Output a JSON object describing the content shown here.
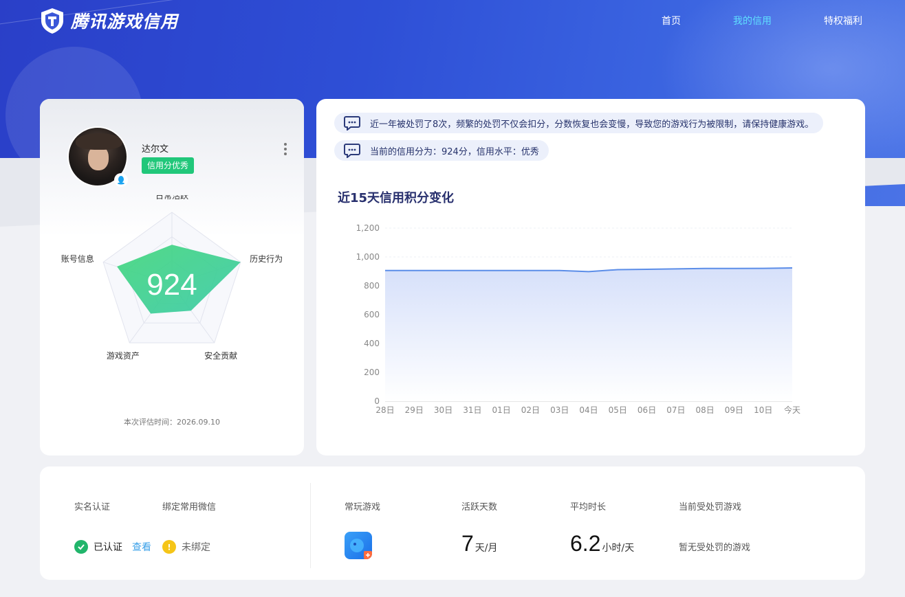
{
  "header": {
    "logo_text": "腾讯游戏信用",
    "nav": [
      {
        "label": "首页",
        "active": false
      },
      {
        "label": "我的信用",
        "active": true
      },
      {
        "label": "特权福利",
        "active": false
      }
    ]
  },
  "profile": {
    "username": "达尔文",
    "badge": "信用分优秀",
    "score": "924",
    "radar_axes": [
      "日常活跃",
      "历史行为",
      "安全贡献",
      "游戏资产",
      "账号信息"
    ],
    "radar_values": [
      0.55,
      1.0,
      0.45,
      0.5,
      0.8
    ],
    "eval_time": "本次评估时间：2026.09.10"
  },
  "messages": [
    "近一年被处罚了8次，频繁的处罚不仅会扣分，分数恢复也会变慢，导致您的游戏行为被限制，请保持健康游戏。",
    "当前的信用分为：924分，信用水平：优秀"
  ],
  "chart_title": "近15天信用积分变化",
  "chart_data": {
    "type": "area",
    "categories": [
      "28日",
      "29日",
      "30日",
      "31日",
      "01日",
      "02日",
      "03日",
      "04日",
      "05日",
      "06日",
      "07日",
      "08日",
      "09日",
      "10日",
      "今天"
    ],
    "values": [
      906,
      906,
      906,
      906,
      906,
      906,
      906,
      898,
      912,
      914,
      917,
      920,
      920,
      921,
      924
    ],
    "ylim": [
      0,
      1200
    ],
    "yticks": [
      "0",
      "200",
      "400",
      "600",
      "800",
      "1,000",
      "1,200"
    ],
    "title": "近15天信用积分变化",
    "xlabel": "",
    "ylabel": "",
    "line_color": "#5b8de8",
    "fill_color": "#dbe4fb"
  },
  "info": {
    "realname_label": "实名认证",
    "wechat_label": "绑定常用微信",
    "realname_status": "已认证",
    "view_link": "查看",
    "wechat_status": "未绑定",
    "frequent_game_label": "常玩游戏",
    "active_days_label": "活跃天数",
    "active_days_value": "7",
    "active_days_unit": "天/月",
    "avg_time_label": "平均时长",
    "avg_time_value": "6.2",
    "avg_time_unit": "小时/天",
    "punished_game_label": "当前受处罚游戏",
    "punished_game_value": "暂无受处罚的游戏"
  },
  "colors": {
    "accent_blue": "#2e4fd6",
    "success_green": "#21c77a",
    "warning_yellow": "#f5c518",
    "nav_active": "#5fe0ff"
  }
}
